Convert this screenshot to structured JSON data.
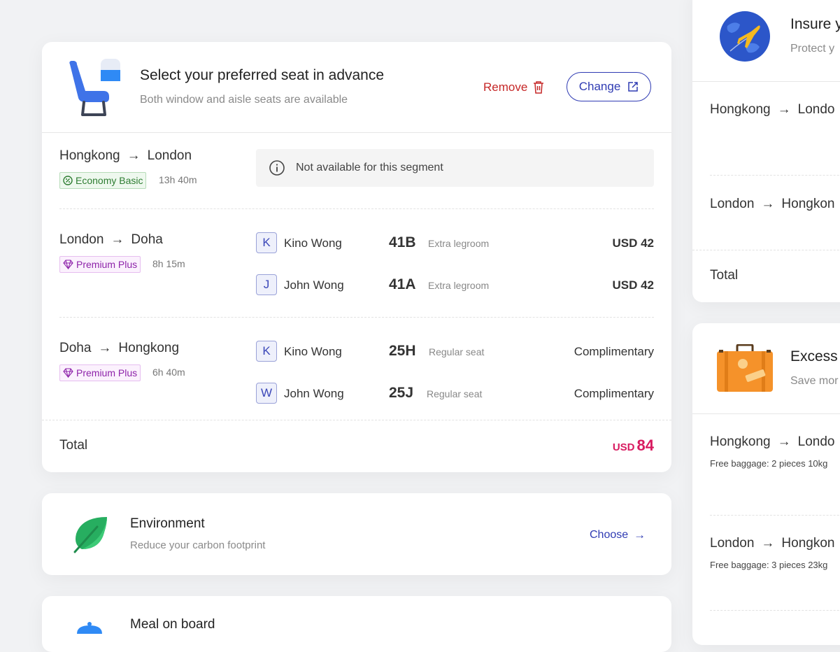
{
  "seat": {
    "title": "Select your preferred seat in advance",
    "subtitle": "Both window and aisle seats are available",
    "remove_label": "Remove",
    "change_label": "Change",
    "segments": [
      {
        "from": "Hongkong",
        "to": "London",
        "fare": "Economy Basic",
        "duration": "13h 40m",
        "notice": "Not available  for this segment"
      },
      {
        "from": "London",
        "to": "Doha",
        "fare": "Premium Plus",
        "duration": "8h 15m",
        "passengers": [
          {
            "initial": "K",
            "name": "Kino Wong",
            "seat": "41B",
            "type": "Extra legroom",
            "price": "USD 42"
          },
          {
            "initial": "J",
            "name": "John Wong",
            "seat": "41A",
            "type": "Extra legroom",
            "price": "USD 42"
          }
        ]
      },
      {
        "from": "Doha",
        "to": "Hongkong",
        "fare": "Premium Plus",
        "duration": "6h 40m",
        "passengers": [
          {
            "initial": "K",
            "name": "Kino Wong",
            "seat": "25H",
            "type": "Regular seat",
            "price": "Complimentary"
          },
          {
            "initial": "W",
            "name": "John Wong",
            "seat": "25J",
            "type": "Regular seat",
            "price": "Complimentary"
          }
        ]
      }
    ],
    "total_label": "Total",
    "total_currency": "USD",
    "total_amount": "84"
  },
  "environment": {
    "title": "Environment",
    "subtitle": "Reduce your carbon footprint",
    "choose_label": "Choose"
  },
  "meal": {
    "title": "Meal on board"
  },
  "insurance": {
    "title": "Insure y",
    "subtitle": "Protect y",
    "routes": [
      {
        "from": "Hongkong",
        "to": "Londo"
      },
      {
        "from": "London",
        "to": "Hongkon"
      }
    ],
    "total_label": "Total"
  },
  "excess": {
    "title": "Excess",
    "subtitle": "Save mor",
    "routes": [
      {
        "from": "Hongkong",
        "to": "Londo",
        "note": "Free baggage: 2 pieces 10kg"
      },
      {
        "from": "London",
        "to": "Hongkon",
        "note": "Free baggage: 3 pieces 23kg"
      }
    ]
  },
  "colors": {
    "primary": "#2f3bb3",
    "danger": "#c62828",
    "total": "#d81b60",
    "economy": "#2e7d32",
    "premium": "#8e24aa"
  }
}
